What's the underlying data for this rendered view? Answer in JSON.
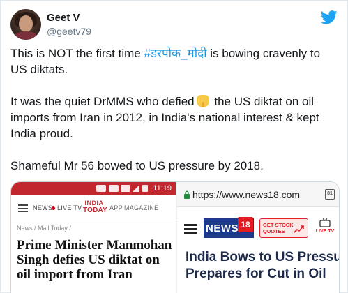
{
  "user": {
    "name": "Geet V",
    "handle": "@geetv79"
  },
  "tweet": {
    "line1_before": "This is NOT the first time ",
    "line1_hashtag": "#डरपोक_मोदी",
    "line1_after": " is bowing cravenly to US diktats.",
    "para2_before": "It was the quiet DrMMS who defied",
    "para2_after": " the US diktat on oil imports from Iran in 2012, in India's national interest & kept India proud.",
    "para3": "Shameful Mr 56 bowed to US pressure by 2018."
  },
  "media_left": {
    "status_time": "11:19",
    "nav_news": "NEWS",
    "nav_live": "LIVE TV",
    "logo_line1": "INDIA",
    "logo_line2": "TODAY",
    "nav_app": "APP",
    "nav_magazine": "MAGAZINE",
    "breadcrumb": "News / Mail Today /",
    "headline": "Prime Minister Manmohan Singh defies US diktat on oil import from Iran",
    "accent_color": "#c2272d"
  },
  "media_right": {
    "url": "https://www.news18.com",
    "tabs_count": "81",
    "logo_text": "NEWS",
    "logo_number": "18",
    "stock_button": "GET STOCK QUOTES",
    "live_tv": "LIVE TV",
    "headline_line1": "India Bows to US Pressure,",
    "headline_line2": "Prepares for Cut in Oil",
    "accent_color": "#1b3a8c"
  },
  "icons": {
    "brand": "twitter-bird-icon",
    "emoji": "backhand-index-pointing-down-icon"
  },
  "colors": {
    "link": "#1b95e0",
    "twitter_blue": "#1da1f2"
  }
}
